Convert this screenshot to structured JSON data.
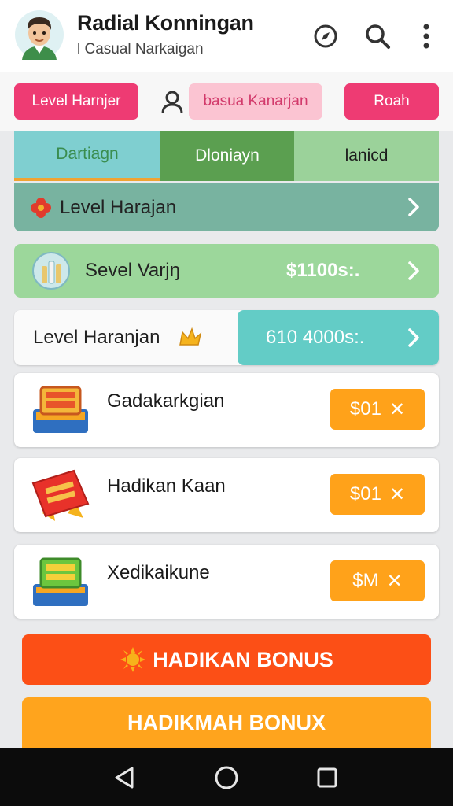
{
  "header": {
    "title": "Radial Konningan",
    "subtitle": "l Casual Narkaigan",
    "icons": [
      "avatar",
      "compass-icon",
      "search-icon",
      "more-vert-icon"
    ]
  },
  "filters": {
    "level": "Level Harnjer",
    "casual": "basua Kanarjan",
    "reach": "Roah"
  },
  "tabs": [
    {
      "label": "Dartiagn",
      "selected": true
    },
    {
      "label": "Dloniayn",
      "selected": false
    },
    {
      "label": "lanicd",
      "selected": false
    }
  ],
  "rows": {
    "row1": {
      "label": "Level Harajan",
      "icon": "flower-icon"
    },
    "row2": {
      "label": "Sevel Varjŋ",
      "value": "$1100s:.",
      "icon": "bottles-icon"
    },
    "row3": {
      "label": "Level Haranjan",
      "value": "610 4000s:.",
      "icon": "crown-icon"
    }
  },
  "cards": [
    {
      "title": "Gadakarkgian",
      "price": "$01",
      "icon": "treasure-box-icon"
    },
    {
      "title": "Hadikan Kaan",
      "price": "$01",
      "icon": "red-tag-icon"
    },
    {
      "title": "Xedikaikune",
      "price": "$M",
      "icon": "green-box-icon"
    }
  ],
  "bonus": {
    "primary": "HADIKAN BONUS",
    "secondary": "HADIKMAH BONUX"
  },
  "colors": {
    "pink": "#ee3b73",
    "orange": "#ffa21a",
    "red_orange": "#fc4f16",
    "teal": "#63ccc6",
    "green": "#5b9f50"
  }
}
